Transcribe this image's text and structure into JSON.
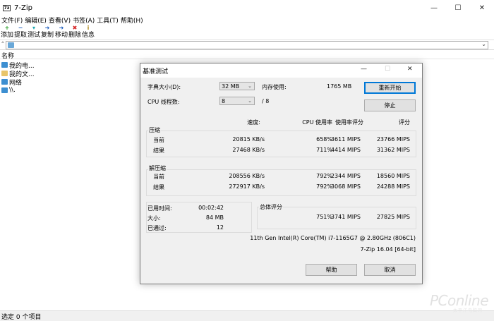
{
  "window": {
    "title": "7-Zip",
    "icon_text": "7z",
    "controls": [
      "—",
      "☐",
      "✕"
    ]
  },
  "menu": [
    "文件(F)",
    "编辑(E)",
    "查看(V)",
    "书签(A)",
    "工具(T)",
    "帮助(H)"
  ],
  "toolbar": {
    "buttons": [
      {
        "label": "添加",
        "icon": "+",
        "color": "#2ca02c"
      },
      {
        "label": "提取",
        "icon": "−",
        "color": "#1f5fbf"
      },
      {
        "label": "测试",
        "icon": "▾",
        "color": "#1aa6b0"
      },
      {
        "label": "复制",
        "icon": "➜",
        "color": "#1f5fbf"
      },
      {
        "label": "移动",
        "icon": "➜",
        "color": "#1f5fbf"
      },
      {
        "label": "删除",
        "icon": "✖",
        "color": "#d62728"
      },
      {
        "label": "信息",
        "icon": "i",
        "color": "#b08a1a"
      }
    ]
  },
  "address": {
    "up_arrow": "⌃",
    "dropdown": "⌄"
  },
  "list": {
    "column_name": "名称",
    "items": [
      {
        "name": "我的电...",
        "icon_color": "#3d8fd1"
      },
      {
        "name": "我的文...",
        "icon_color": "#e8c56a"
      },
      {
        "name": "网络",
        "icon_color": "#3d8fd1"
      },
      {
        "name": "\\\\.",
        "icon_color": "#3d8fd1"
      }
    ]
  },
  "status": {
    "text": "选定 0 个项目"
  },
  "watermark": {
    "main": "PConline",
    "sub": "太平洋电脑网"
  },
  "dialog": {
    "title": "基准测试",
    "controls": [
      "—",
      "☐",
      "✕"
    ],
    "dict_label": "字典大小(D):",
    "dict_value": "32 MB",
    "mem_label": "内存使用:",
    "mem_value": "1765 MB",
    "threads_label": "CPU 线程数:",
    "threads_value": "8",
    "threads_total": "/ 8",
    "restart_button": "重新开始",
    "stop_button": "停止",
    "headers": {
      "speed": "速度:",
      "cpu": "CPU 使用率",
      "rating_usage": "使用率评分",
      "rating": "评分"
    },
    "compress": {
      "label": "压缩",
      "rows": [
        {
          "label": "当前",
          "speed": "20815 KB/s",
          "cpu": "658%",
          "usage": "3611 MIPS",
          "rating": "23766 MIPS"
        },
        {
          "label": "结果",
          "speed": "27468 KB/s",
          "cpu": "711%",
          "usage": "4414 MIPS",
          "rating": "31362 MIPS"
        }
      ]
    },
    "decompress": {
      "label": "解压缩",
      "rows": [
        {
          "label": "当前",
          "speed": "208556 KB/s",
          "cpu": "792%",
          "usage": "2344 MIPS",
          "rating": "18560 MIPS"
        },
        {
          "label": "结果",
          "speed": "272917 KB/s",
          "cpu": "792%",
          "usage": "3068 MIPS",
          "rating": "24288 MIPS"
        }
      ]
    },
    "elapsed_label": "已用时间:",
    "elapsed_value": "00:02:42",
    "size_label": "大小:",
    "size_value": "84 MB",
    "passes_label": "已通过:",
    "passes_value": "12",
    "total_label": "总体评分",
    "total": {
      "cpu": "751%",
      "usage": "3741 MIPS",
      "rating": "27825 MIPS"
    },
    "cpu_info": "11th Gen Intel(R) Core(TM) i7-1165G7 @ 2.80GHz (806C1)",
    "version": "7-Zip 16.04 [64-bit]",
    "help_button": "帮助",
    "cancel_button": "取消"
  }
}
